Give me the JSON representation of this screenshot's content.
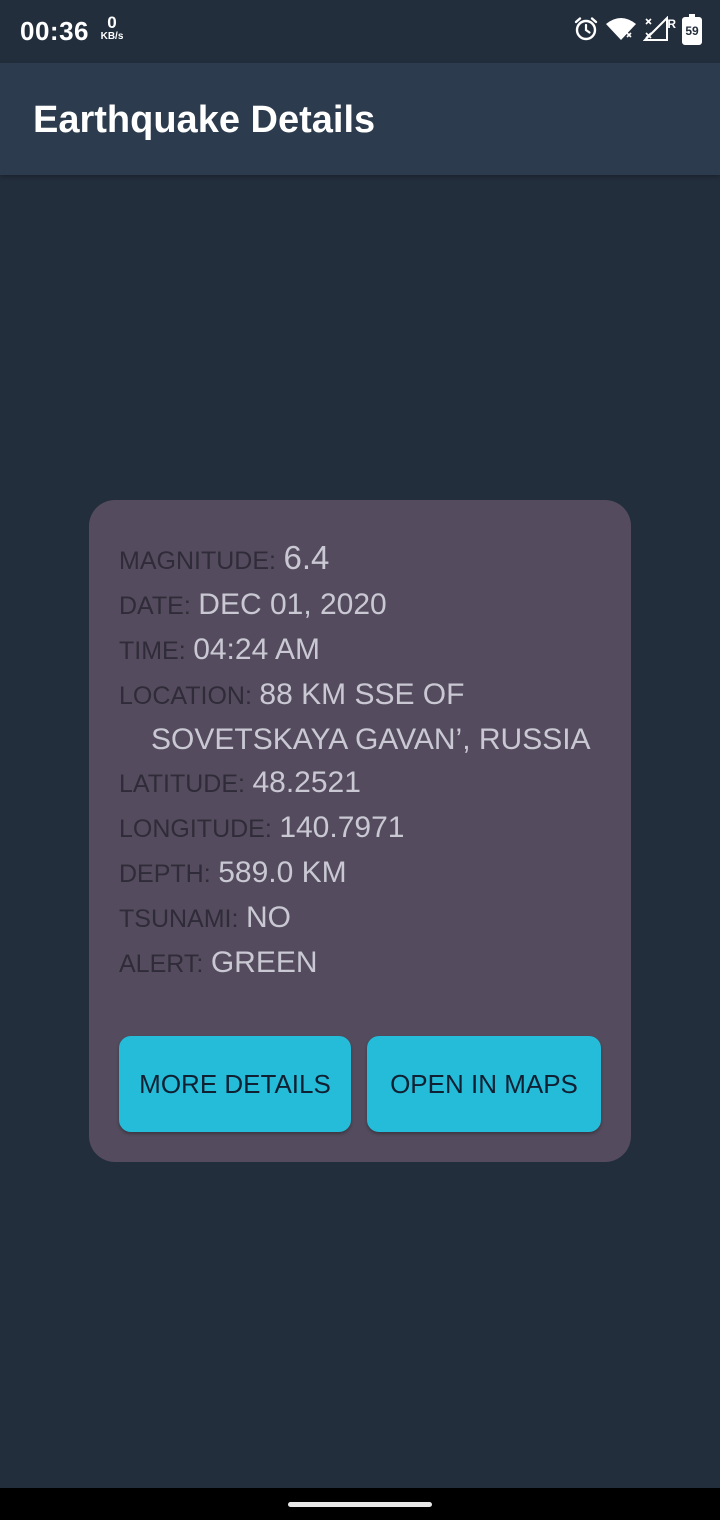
{
  "status_bar": {
    "time": "00:36",
    "net_speed_value": "0",
    "net_speed_unit": "KB/s",
    "roaming_indicator": "R",
    "battery_level": "59",
    "icons": [
      "alarm-icon",
      "wifi-icon",
      "cellular-signal-icon",
      "battery-icon"
    ]
  },
  "app_bar": {
    "title": "Earthquake Details"
  },
  "details": {
    "magnitude_label": "MAGNITUDE:",
    "magnitude_value": "6.4",
    "date_label": "DATE:",
    "date_value": "DEC 01, 2020",
    "time_label": "TIME:",
    "time_value": "04:24 AM",
    "location_label": "LOCATION:",
    "location_value_line1": "88 KM SSE OF",
    "location_value_line2": "SOVETSKAYA GAVAN’, RUSSIA",
    "latitude_label": "LATITUDE:",
    "latitude_value": "48.2521",
    "longitude_label": "LONGITUDE:",
    "longitude_value": "140.7971",
    "depth_label": "DEPTH:",
    "depth_value": "589.0 KM",
    "tsunami_label": "TSUNAMI:",
    "tsunami_value": "NO",
    "alert_label": "ALERT:",
    "alert_value": "GREEN"
  },
  "buttons": {
    "more_details": "MORE DETAILS",
    "open_in_maps": "OPEN IN MAPS"
  },
  "colors": {
    "background": "#232e3c",
    "app_bar": "#2c3b4d",
    "card": "#544c5e",
    "button": "#24bcd8"
  }
}
